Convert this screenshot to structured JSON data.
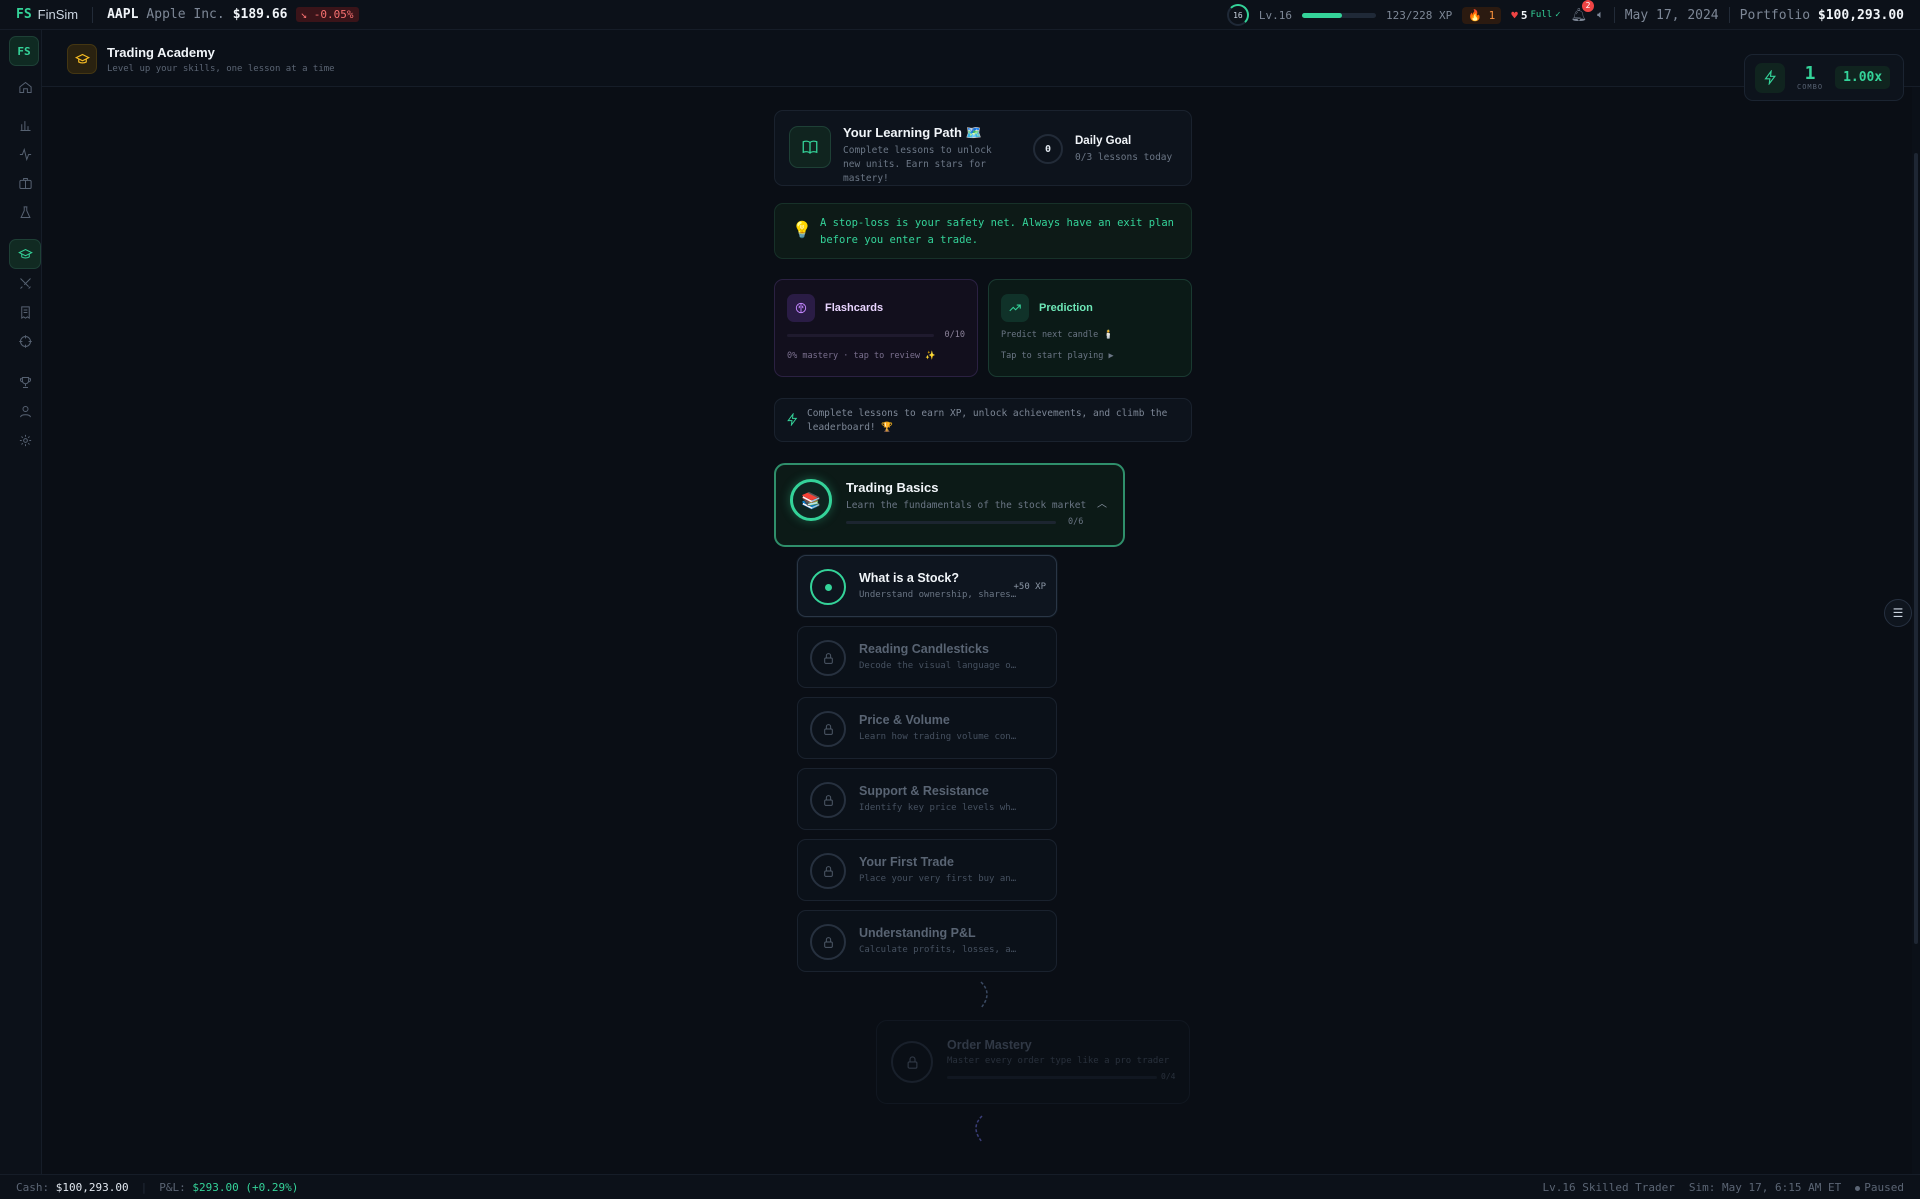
{
  "topbar": {
    "brand_short": "FS",
    "brand_name": "FinSim",
    "symbol": "AAPL",
    "company": "Apple Inc.",
    "price": "$189.66",
    "change": "-0.05%",
    "level_badge": "16",
    "level_label": "Lv.16",
    "xp_progress": 0.54,
    "xp_text": "123/228 XP",
    "streak": "1",
    "hearts": "5",
    "hearts_status": "Full",
    "notifications": "2",
    "date": "May 17, 2024",
    "portfolio_label": "Portfolio",
    "portfolio_value": "$100,293.00"
  },
  "sidebar": {
    "logo": "FS",
    "items": [
      {
        "name": "home-icon"
      },
      {
        "name": "bar-chart-icon"
      },
      {
        "name": "activity-icon"
      },
      {
        "name": "briefcase-icon"
      },
      {
        "name": "flask-icon"
      },
      {
        "name": "graduation-cap-icon",
        "active": true
      },
      {
        "name": "swords-icon"
      },
      {
        "name": "receipt-icon"
      },
      {
        "name": "crosshair-icon"
      },
      {
        "name": "trophy-icon"
      },
      {
        "name": "user-icon"
      },
      {
        "name": "settings-icon"
      }
    ]
  },
  "header": {
    "title": "Trading Academy",
    "subtitle": "Level up your skills, one lesson at a time"
  },
  "combo": {
    "count": "1",
    "label": "COMBO",
    "multiplier": "1.00x"
  },
  "learning_path": {
    "title": "Your Learning Path 🗺️",
    "description": "Complete lessons to unlock new units. Earn stars for mastery!",
    "goal_value": "0",
    "goal_title": "Daily Goal",
    "goal_sub": "0/3 lessons today"
  },
  "tip": {
    "text": "A stop-loss is your safety net. Always have an exit plan before you enter a trade."
  },
  "flashcards": {
    "title": "Flashcards",
    "count": "0/10",
    "mastery": 0,
    "footer": "0% mastery · tap to review ✨"
  },
  "prediction": {
    "title": "Prediction",
    "subtitle": "Predict next candle 🕯️",
    "footer": "Tap to start playing ▶"
  },
  "info": {
    "text": "Complete lessons to earn XP, unlock achievements, and climb the leaderboard! 🏆"
  },
  "unit1": {
    "emoji": "📚",
    "title": "Trading Basics",
    "subtitle": "Learn the fundamentals of the stock market",
    "progress_text": "0/6",
    "progress": 0
  },
  "lessons": [
    {
      "title": "What is a Stock?",
      "subtitle": "Understand ownership, shares, and equity",
      "xp": "+50 XP",
      "current": true
    },
    {
      "title": "Reading Candlesticks",
      "subtitle": "Decode the visual language of price"
    },
    {
      "title": "Price & Volume",
      "subtitle": "Learn how trading volume confirms moves"
    },
    {
      "title": "Support & Resistance",
      "subtitle": "Identify key price levels where markets turn"
    },
    {
      "title": "Your First Trade",
      "subtitle": "Place your very first buy and sell"
    },
    {
      "title": "Understanding P&L",
      "subtitle": "Calculate profits, losses, and returns"
    }
  ],
  "unit2": {
    "title": "Order Mastery",
    "subtitle": "Master every order type like a pro trader",
    "progress_text": "0/4"
  },
  "statusbar": {
    "cash_label": "Cash:",
    "cash_value": "$100,293.00",
    "pnl_label": "P&L:",
    "pnl_value": "$293.00 (+0.29%)",
    "rank": "Lv.16 Skilled Trader",
    "sim_time": "Sim: May 17, 6:15 AM ET",
    "state": "Paused"
  }
}
